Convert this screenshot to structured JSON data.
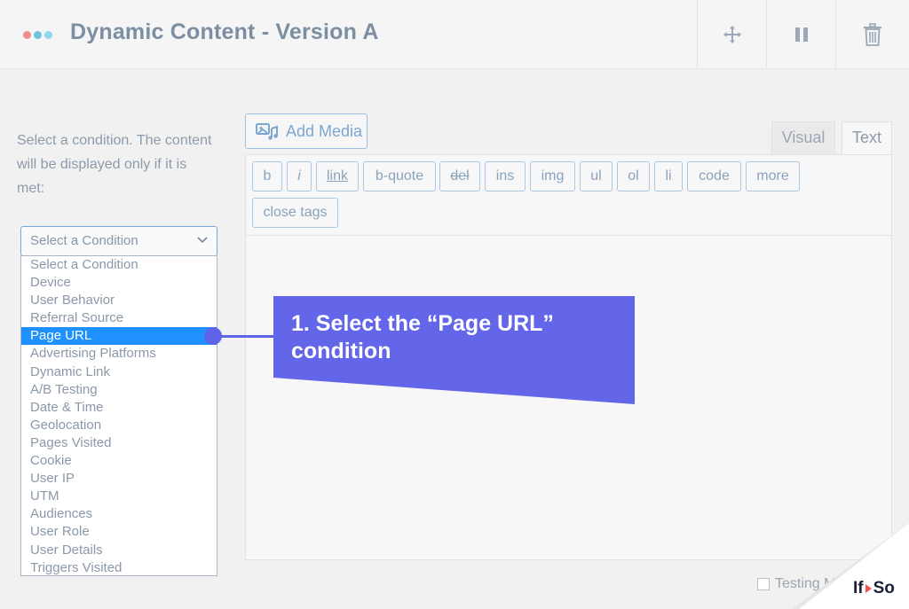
{
  "header": {
    "title": "Dynamic Content - Version A",
    "dot_colors": [
      "#f08c8c",
      "#6fc3e0",
      "#8fd7ee"
    ],
    "actions": [
      {
        "name": "move-button",
        "icon": "move-arrows-icon"
      },
      {
        "name": "pause-button",
        "icon": "pause-icon"
      },
      {
        "name": "delete-button",
        "icon": "trash-icon"
      }
    ]
  },
  "condition": {
    "instructions": "Select a condition. The content will be displayed only if it is met:",
    "select_value": "Select a Condition",
    "options": [
      "Select a Condition",
      "Device",
      "User Behavior",
      "Referral Source",
      "Page URL",
      "Advertising Platforms",
      "Dynamic Link",
      "A/B Testing",
      "Date & Time",
      "Geolocation",
      "Pages Visited",
      "Cookie",
      "User IP",
      "UTM",
      "Audiences",
      "User Role",
      "User Details",
      "Triggers Visited"
    ],
    "highlighted_option": "Page URL"
  },
  "editor": {
    "add_media_label": "Add Media",
    "tabs": {
      "visual": "Visual",
      "text": "Text"
    },
    "quicktags": [
      "b",
      "i",
      "link",
      "b-quote",
      "del",
      "ins",
      "img",
      "ul",
      "ol",
      "li",
      "code",
      "more",
      "close tags"
    ]
  },
  "callout": {
    "text": "1. Select the “Page URL” condition",
    "color": "#6366e8"
  },
  "footer": {
    "testing_label": "Testing M"
  },
  "brand": {
    "logo_left": "If",
    "logo_right": "So"
  }
}
